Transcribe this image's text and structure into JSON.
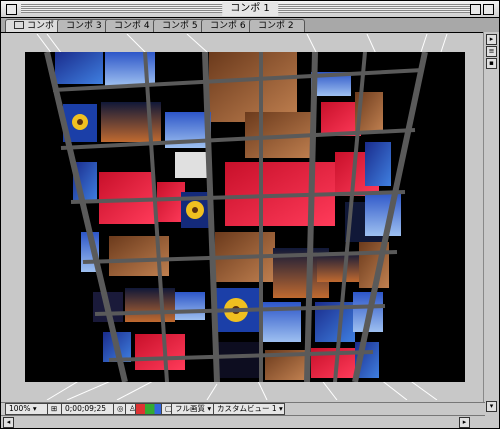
{
  "window": {
    "title": "コンポ 1"
  },
  "tabs": [
    {
      "label": "コンポ 1",
      "active": true
    },
    {
      "label": "コンポ 3",
      "active": false
    },
    {
      "label": "コンポ 4",
      "active": false
    },
    {
      "label": "コンポ 5",
      "active": false
    },
    {
      "label": "コンポ 6",
      "active": false
    },
    {
      "label": "コンポ 2",
      "active": false
    }
  ],
  "viewer": {
    "background": "#000000",
    "frame_color": "#5a5a5a",
    "guide_color": "#ffffff",
    "content": "3D tower of photo tiles"
  },
  "bottom_bar": {
    "zoom": "100%",
    "timecode": "0;00;09;25",
    "resolution": "フル画質",
    "view": "カスタムビュー 1"
  },
  "icons": {
    "close": "close-box-icon",
    "zoom": "zoom-box-icon",
    "collapse": "collapse-box-icon"
  }
}
